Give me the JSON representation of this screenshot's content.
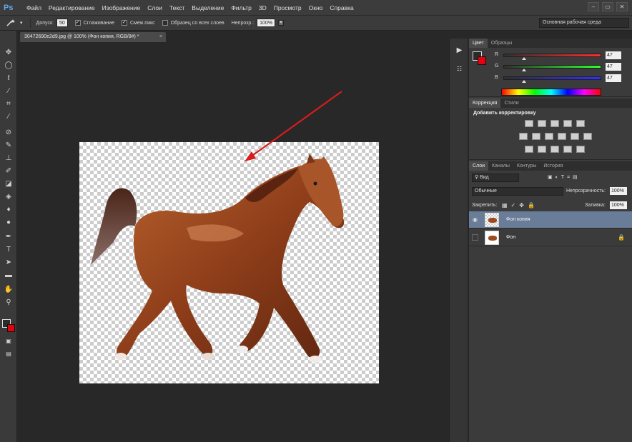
{
  "app": {
    "logo": "Ps"
  },
  "menu": [
    "Файл",
    "Редактирование",
    "Изображение",
    "Слои",
    "Текст",
    "Выделение",
    "Фильтр",
    "3D",
    "Просмотр",
    "Окно",
    "Справка"
  ],
  "window_controls": [
    "–",
    "▭",
    "✕"
  ],
  "options": {
    "tolerance_label": "Допуск:",
    "tolerance_value": "50",
    "antialias_label": "Сглаживание",
    "contiguous_label": "Смеж.пикс",
    "sample_all_label": "Образец со всех слоев",
    "opacity_label": "Непрозр.:",
    "opacity_value": "100%",
    "workspace": "Основная рабочая среда"
  },
  "document": {
    "tab_title": "30472690e2d9.jpg @ 100% (Фон копия, RGB/8#) *",
    "close": "×",
    "annotation_color": "#d61c1c"
  },
  "tools": [
    "move-tool-icon",
    "marquee-tool-icon",
    "lasso-tool-icon",
    "quick-select-icon",
    "crop-tool-icon",
    "eyedropper-icon",
    "heal-brush-icon",
    "brush-tool-icon",
    "clone-stamp-icon",
    "history-brush-icon",
    "eraser-tool-icon",
    "gradient-tool-icon",
    "blur-tool-icon",
    "dodge-tool-icon",
    "pen-tool-icon",
    "type-tool-icon",
    "path-select-icon",
    "shape-tool-icon",
    "hand-tool-icon",
    "zoom-tool-icon"
  ],
  "color_panel": {
    "tabs": [
      "Цвет",
      "Образцы"
    ],
    "channels": [
      {
        "label": "R",
        "value": "47"
      },
      {
        "label": "G",
        "value": "47"
      },
      {
        "label": "B",
        "value": "47"
      }
    ],
    "foreground": "#2b2b2b",
    "background": "#e3000f"
  },
  "adjust_panel": {
    "tabs": [
      "Коррекция",
      "Стили"
    ],
    "title": "Добавить корректировку"
  },
  "layers_panel": {
    "tabs": [
      "Слои",
      "Каналы",
      "Контуры",
      "История"
    ],
    "filter": "Вид",
    "blend_mode": "Обычные",
    "opacity_label": "Непрозрачность:",
    "opacity_value": "100%",
    "lock_label": "Закрепить:",
    "fill_label": "Заливка:",
    "fill_value": "100%",
    "layers": [
      {
        "name": "Фон копия",
        "selected": true
      },
      {
        "name": "Фон",
        "selected": false
      }
    ]
  }
}
